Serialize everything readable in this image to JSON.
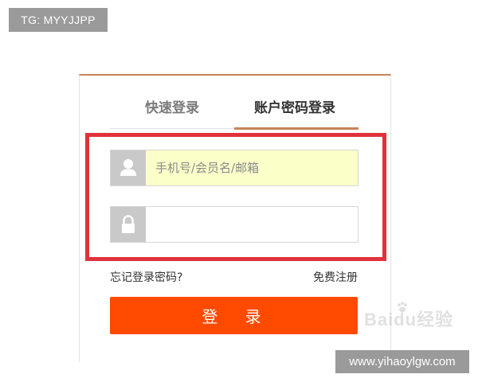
{
  "badges": {
    "tg": "TG: MYYJJPP",
    "site": "www.yihaoylgw.com"
  },
  "login": {
    "tabs": {
      "quick": "快速登录",
      "account": "账户密码登录",
      "active": "account"
    },
    "username": {
      "placeholder": "手机号/会员名/邮箱",
      "value": "",
      "icon": "user-icon"
    },
    "password": {
      "placeholder": "",
      "value": "",
      "icon": "lock-icon"
    },
    "forgot_label": "忘记登录密码?",
    "register_label": "免费注册",
    "submit_label": "登 录"
  },
  "watermark": {
    "text": "Baidu经验"
  },
  "colors": {
    "accent": "#ff4a00",
    "highlight": "#e0323b",
    "tab_underline": "#c9835a",
    "username_bg": "#fbffc8"
  }
}
